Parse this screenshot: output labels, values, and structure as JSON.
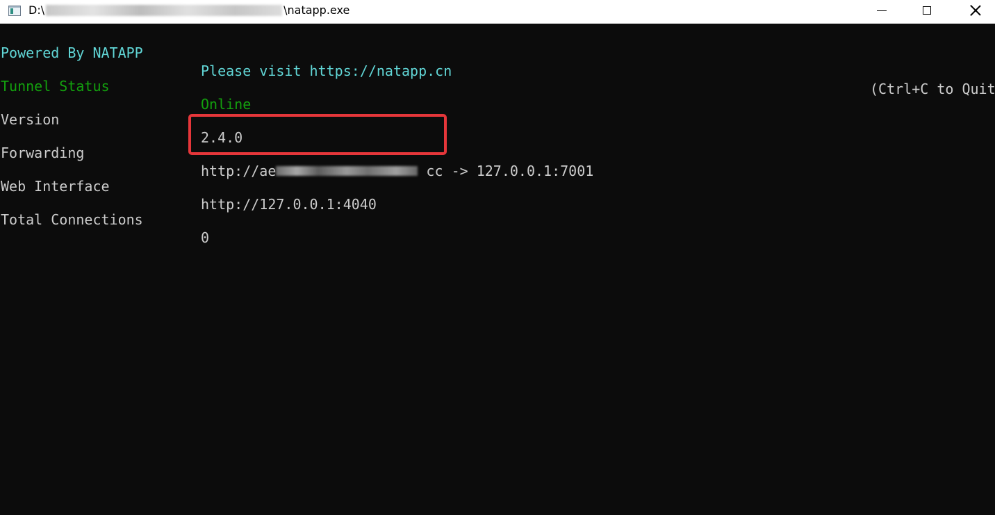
{
  "window": {
    "title_prefix": "D:\\",
    "title_suffix": "\\natapp.exe"
  },
  "console": {
    "powered_by": "Powered By NATAPP",
    "please_visit": "Please visit https://natapp.cn",
    "quit_hint": "(Ctrl+C to Quit)",
    "rows": [
      {
        "label": "Tunnel Status",
        "value": "Online"
      },
      {
        "label": "Version",
        "value": "2.4.0"
      },
      {
        "label": "Forwarding",
        "value_prefix": "http://ae",
        "value_suffix": "cc",
        "arrow": "->",
        "target": "127.0.0.1:7001"
      },
      {
        "label": "Web Interface",
        "value": "http://127.0.0.1:4040"
      },
      {
        "label": "Total Connections",
        "value": "0"
      }
    ]
  },
  "colors": {
    "console_bg": "#0c0c0c",
    "cyan_text": "#61d6d6",
    "green_text": "#13a10e",
    "default_text": "#cccccc",
    "highlight_border": "#e5363a"
  },
  "icons": {
    "app": "console-window-icon",
    "minimize": "minimize-icon",
    "maximize": "maximize-icon",
    "close": "close-icon"
  }
}
